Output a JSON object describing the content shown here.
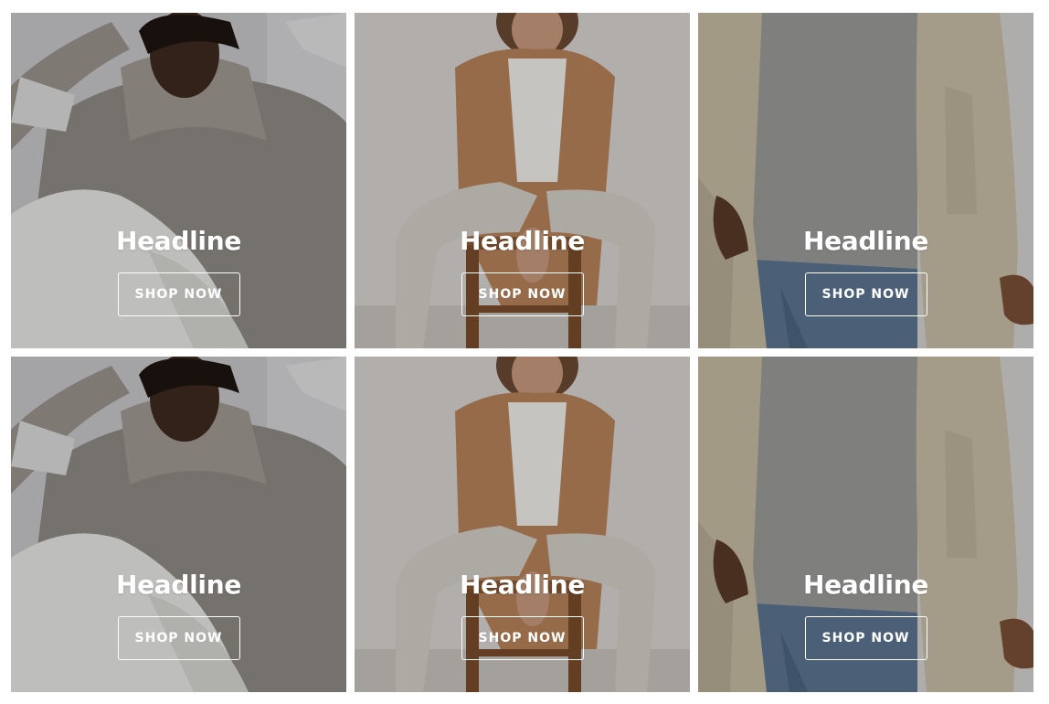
{
  "cards": [
    {
      "headline": "Headline",
      "button_label": "SHOP NOW",
      "image": "hoodie-model-photo"
    },
    {
      "headline": "Headline",
      "button_label": "SHOP NOW",
      "image": "camel-coat-model-photo"
    },
    {
      "headline": "Headline",
      "button_label": "SHOP NOW",
      "image": "linen-jacket-model-photo"
    },
    {
      "headline": "Headline",
      "button_label": "SHOP NOW",
      "image": "hoodie-model-photo"
    },
    {
      "headline": "Headline",
      "button_label": "SHOP NOW",
      "image": "camel-coat-model-photo"
    },
    {
      "headline": "Headline",
      "button_label": "SHOP NOW",
      "image": "linen-jacket-model-photo"
    }
  ],
  "colors": {
    "text": "#ffffff",
    "button_border": "#ffffff",
    "page_background": "#ffffff"
  }
}
